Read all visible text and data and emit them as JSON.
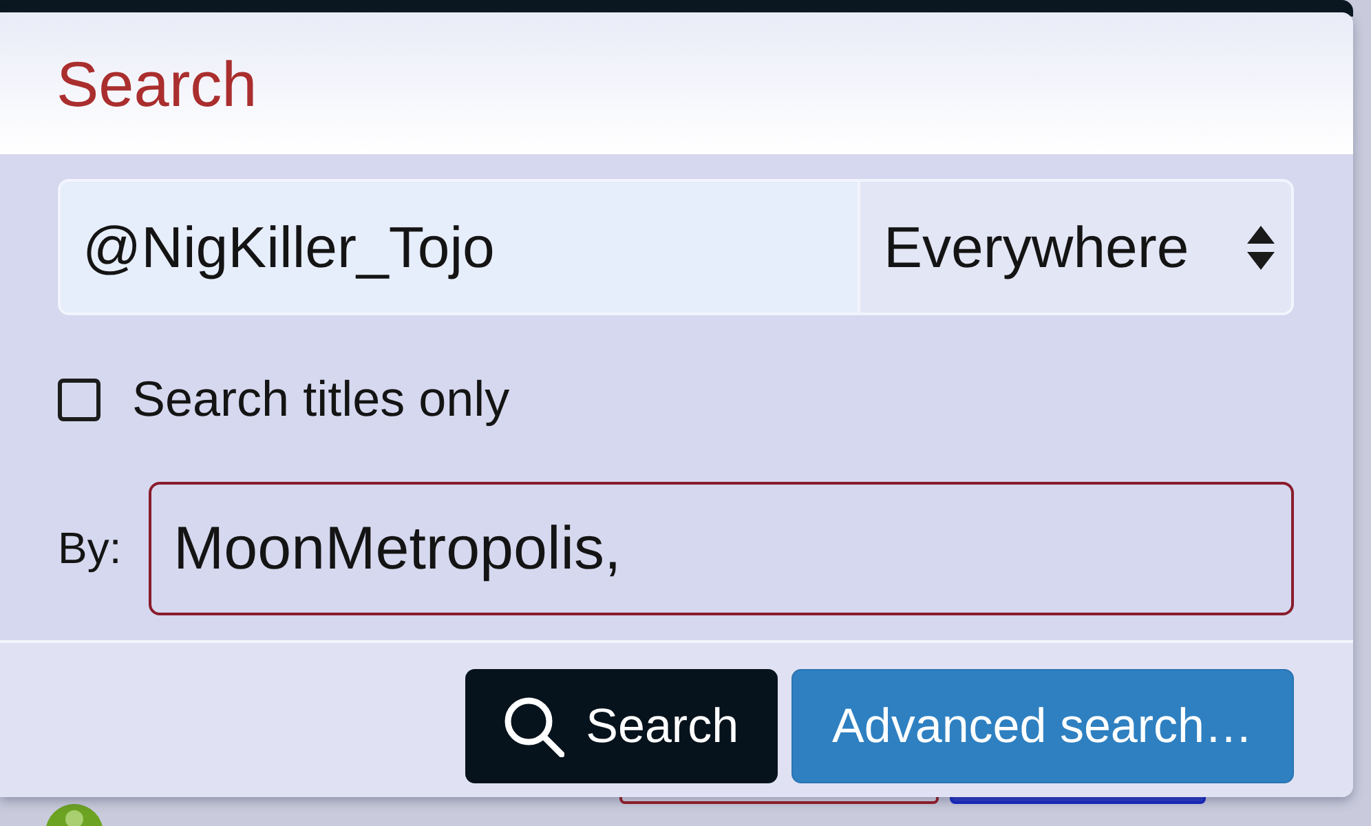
{
  "dialog": {
    "title": "Search"
  },
  "query": {
    "value": "@NigKiller_Tojo"
  },
  "scope": {
    "value": "Everywhere"
  },
  "options": [
    {
      "label": "Search titles only",
      "checked": false
    }
  ],
  "by_field": {
    "label": "By:",
    "value": "MoonMetropolis,",
    "focused": true
  },
  "buttons": [
    {
      "label": "Search",
      "kind": "primary"
    },
    {
      "label": "Advanced search…",
      "kind": "secondary"
    }
  ]
}
